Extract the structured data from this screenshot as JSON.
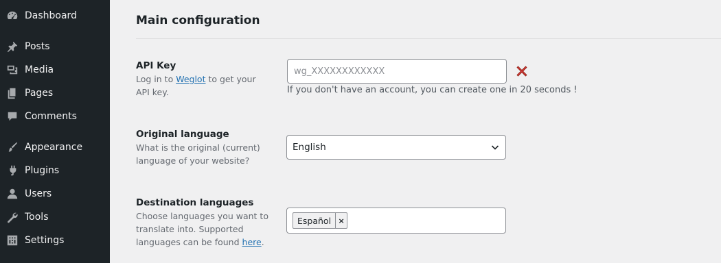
{
  "sidebar": {
    "items": [
      {
        "label": "Dashboard",
        "icon": "dashboard-icon"
      },
      {
        "label": "Posts",
        "icon": "pin-icon"
      },
      {
        "label": "Media",
        "icon": "media-icon"
      },
      {
        "label": "Pages",
        "icon": "pages-icon"
      },
      {
        "label": "Comments",
        "icon": "comment-icon"
      },
      {
        "label": "Appearance",
        "icon": "brush-icon"
      },
      {
        "label": "Plugins",
        "icon": "plug-icon"
      },
      {
        "label": "Users",
        "icon": "user-icon"
      },
      {
        "label": "Tools",
        "icon": "wrench-icon"
      },
      {
        "label": "Settings",
        "icon": "settings-icon"
      }
    ]
  },
  "main": {
    "title": "Main configuration",
    "api_key": {
      "label": "API Key",
      "desc_pre": "Log in to ",
      "desc_link": "Weglot",
      "desc_post": " to get your API key.",
      "placeholder": "wg_XXXXXXXXXXXX",
      "value": "",
      "hint": "If you don't have an account, you can create one in 20 seconds !",
      "status_icon": "red-x-icon"
    },
    "original_language": {
      "label": "Original language",
      "desc": "What is the original (current) language of your website?",
      "selected": "English"
    },
    "destination_languages": {
      "label": "Destination languages",
      "desc_pre": "Choose languages you want to translate into. Supported languages can be found ",
      "desc_link": "here",
      "desc_post": ".",
      "tags": [
        "Español"
      ],
      "remove_symbol": "×"
    }
  },
  "colors": {
    "sidebar_bg": "#1d2327",
    "page_bg": "#f0f0f1",
    "link": "#2271b1",
    "error_x": "#d63638"
  }
}
